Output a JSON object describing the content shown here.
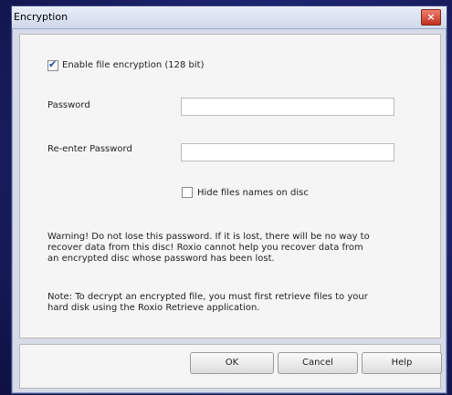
{
  "window": {
    "title": "Encryption",
    "close_glyph": "×"
  },
  "options": {
    "enable_encryption": {
      "label": "Enable file encryption (128 bit)",
      "checked": true
    },
    "hide_names": {
      "label": "Hide files names on disc",
      "checked": false
    }
  },
  "fields": {
    "password": {
      "label": "Password",
      "value": ""
    },
    "reenter_password": {
      "label": "Re-enter Password",
      "value": ""
    }
  },
  "messages": {
    "warning": [
      "Warning! Do not lose this password.  If it is lost, there will be no way to",
      "recover data from this disc!  Roxio cannot help you recover data from",
      "an encrypted disc whose password has been lost."
    ],
    "note": [
      "Note: To decrypt an encrypted file, you must first retrieve files to your",
      "hard disk using the Roxio Retrieve application."
    ]
  },
  "buttons": {
    "ok": "OK",
    "cancel": "Cancel",
    "help": "Help"
  },
  "icons": {
    "check": "✔"
  }
}
